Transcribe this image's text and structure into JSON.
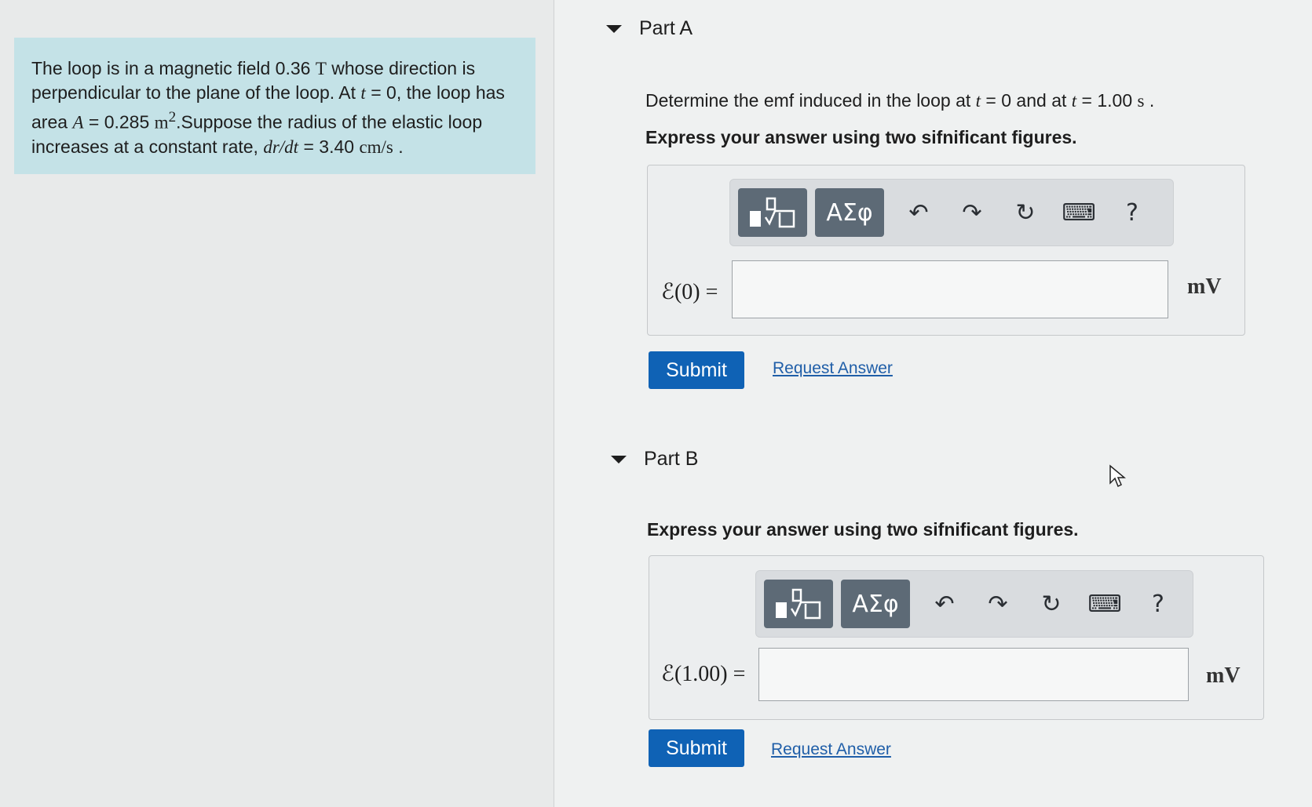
{
  "problem": {
    "line1_pre": "The loop is in a magnetic field 0.36 ",
    "line1_unit": "T",
    "line1_post": " whose direction is",
    "line2_pre": "perpendicular to the plane of the loop. At ",
    "line2_var": "t",
    "line2_post": " = 0, the loop has",
    "line3_pre": "area ",
    "line3_var": "A",
    "line3_eq": " = 0.285 ",
    "line3_unit": "m",
    "line3_exp": "2",
    "line3_post": ".Suppose the radius of the elastic loop",
    "line4_pre": "increases at a constant rate, ",
    "line4_var": "dr/dt",
    "line4_eq": " = 3.40 ",
    "line4_unit": "cm/s",
    "line4_post": " ."
  },
  "partA": {
    "title": "Part A",
    "question_pre": "Determine the emf induced in the loop at ",
    "t_var": "t",
    "question_mid": " = 0 and at ",
    "question_eq": " = 1.00 ",
    "question_unit": "s",
    "question_post": " .",
    "instruction": "Express your answer using two sifnificant figures.",
    "toolbar": {
      "templates_icon": "templates-icon",
      "greek": "ΑΣφ",
      "undo": "↶",
      "redo": "↷",
      "reset": "↻",
      "keyboard": "⌨",
      "help": "?"
    },
    "label": "ℰ(0) =",
    "unit": "mV",
    "input_value": "",
    "submit": "Submit",
    "request": "Request Answer"
  },
  "partB": {
    "title": "Part B",
    "instruction": "Express your answer using two sifnificant figures.",
    "toolbar": {
      "templates_icon": "templates-icon",
      "greek": "ΑΣφ",
      "undo": "↶",
      "redo": "↷",
      "reset": "↻",
      "keyboard": "⌨",
      "help": "?"
    },
    "label": "ℰ(1.00) =",
    "unit": "mV",
    "input_value": "",
    "submit": "Submit",
    "request": "Request Answer"
  }
}
